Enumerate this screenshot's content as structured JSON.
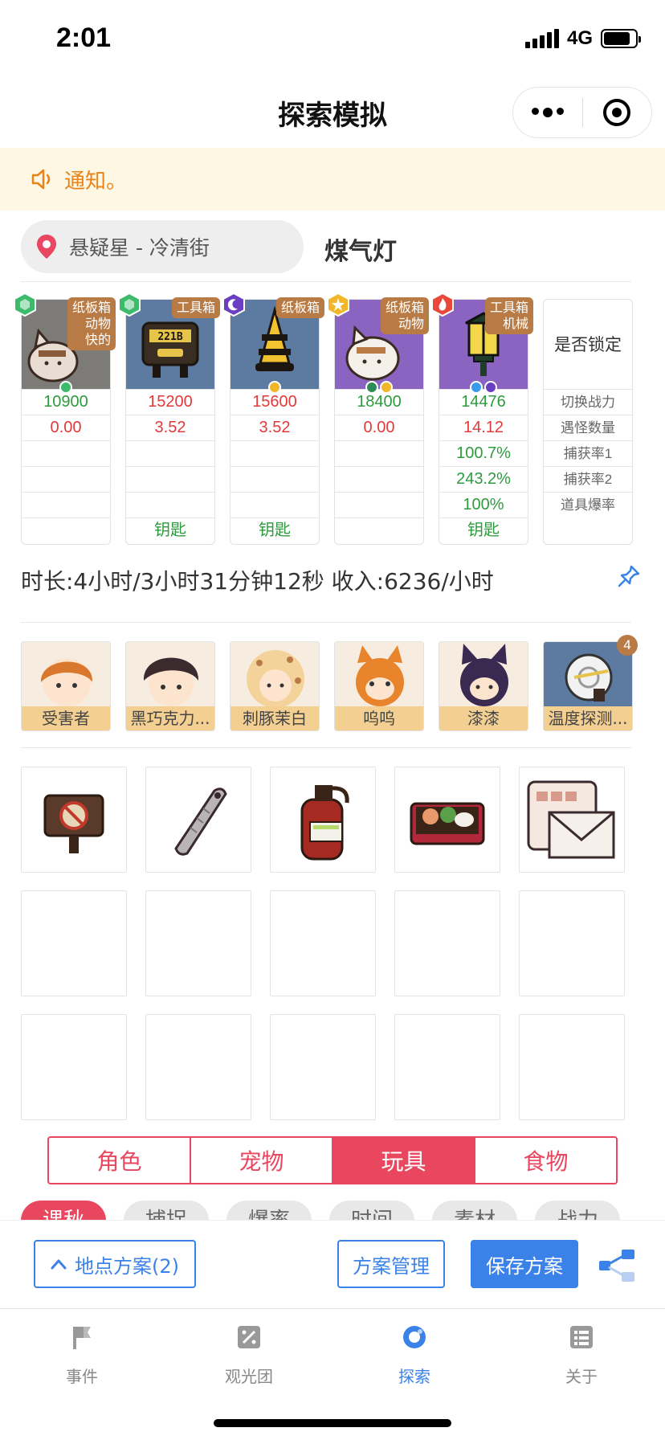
{
  "status_bar": {
    "time": "2:01",
    "network": "4G"
  },
  "nav": {
    "title": "探索模拟"
  },
  "notice": {
    "text": "通知。"
  },
  "location": {
    "area": "悬疑星 - 冷清街",
    "spot": "煤气灯"
  },
  "pets": [
    {
      "tag": "纸板箱\n动物\n快的",
      "element": "green",
      "minis": [
        "green"
      ],
      "power": "10900",
      "count": "0.00",
      "rate1": "",
      "rate2": "",
      "drop": "",
      "loot": "",
      "bg": "#7d7b78"
    },
    {
      "tag": "工具箱",
      "element": "green",
      "minis": [],
      "power": "15200",
      "count": "3.52",
      "rate1": "",
      "rate2": "",
      "drop": "",
      "loot": "钥匙",
      "bg": "#5d7ba0",
      "plate": "221B"
    },
    {
      "tag": "纸板箱",
      "element": "purple",
      "minis": [
        "yellow"
      ],
      "power": "15600",
      "count": "3.52",
      "rate1": "",
      "rate2": "",
      "drop": "",
      "loot": "钥匙",
      "bg": "#5d7ba0"
    },
    {
      "tag": "纸板箱\n动物",
      "element": "yellow",
      "minis": [
        "green",
        "yellow"
      ],
      "power": "18400",
      "count": "0.00",
      "rate1": "",
      "rate2": "",
      "drop": "",
      "loot": "",
      "bg": "#8b63c0"
    },
    {
      "tag": "工具箱\n机械",
      "element": "red",
      "minis": [
        "blue",
        "purple"
      ],
      "power": "14476",
      "count": "14.12",
      "rate1": "100.7%",
      "rate2": "243.2%",
      "drop": "100%",
      "loot": "钥匙",
      "bg": "#8b63c0"
    }
  ],
  "lock_column": {
    "header": "是否锁定",
    "rows": [
      "切换战力",
      "遇怪数量",
      "捕获率1",
      "捕获率2",
      "道具爆率"
    ]
  },
  "summary": {
    "text": "时长:4小时/3小时31分钟12秒 收入:6236/小时"
  },
  "characters": [
    {
      "name": "受害者",
      "bg": "#f7ece0"
    },
    {
      "name": "黑巧克力...",
      "bg": "#f7ece0"
    },
    {
      "name": "刺豚茉白",
      "bg": "#f7ece0"
    },
    {
      "name": "呜呜",
      "bg": "#f7ece0"
    },
    {
      "name": "漆漆",
      "bg": "#f7ece0"
    },
    {
      "name": "温度探测...",
      "bg": "#5d7ba0"
    }
  ],
  "character_badge": "4",
  "items": [
    {
      "icon": "no-sign-icon"
    },
    {
      "icon": "ruler-tag-icon"
    },
    {
      "icon": "fire-extinguisher-icon"
    },
    {
      "icon": "bento-box-icon"
    },
    {
      "icon": "letter-icon"
    }
  ],
  "tabs": [
    {
      "label": "角色",
      "active": false
    },
    {
      "label": "宠物",
      "active": false
    },
    {
      "label": "玩具",
      "active": true
    },
    {
      "label": "食物",
      "active": false
    }
  ],
  "chips": [
    "课秋",
    "捕捉",
    "爆率",
    "时间",
    "素材",
    "战力"
  ],
  "actions": {
    "location_plan": "地点方案(2)",
    "manage": "方案管理",
    "save": "保存方案"
  },
  "tabbar": [
    {
      "label": "事件",
      "active": false
    },
    {
      "label": "观光团",
      "active": false
    },
    {
      "label": "探索",
      "active": true
    },
    {
      "label": "关于",
      "active": false
    }
  ],
  "colors": {
    "accent_red": "#e8475f",
    "accent_blue": "#3b82e8",
    "notice_orange": "#e8831a",
    "tag_brown": "#b87b46"
  }
}
